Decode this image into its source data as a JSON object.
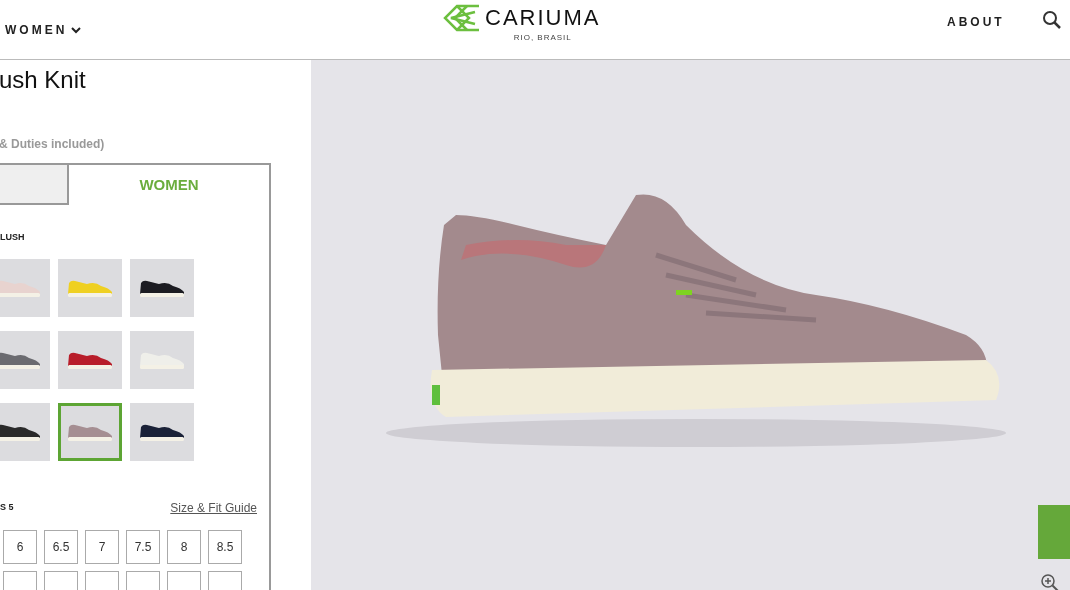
{
  "nav": {
    "menu": "WOMEN",
    "about": "ABOUT"
  },
  "logo": {
    "name": "CARIUMA",
    "tagline": "RIO, BRASIL"
  },
  "product": {
    "title": "ush Knit",
    "price_note": "& Duties included)"
  },
  "tabs": [
    {
      "selected": false
    },
    {
      "label": "WOMEN",
      "selected": true
    }
  ],
  "color_label": "LUSH",
  "swatches": [
    {
      "color": "#e8d3cf",
      "selected": false
    },
    {
      "color": "#efd021",
      "selected": false
    },
    {
      "color": "#1c1c22",
      "selected": false
    },
    {
      "color": "#6b6b70",
      "selected": false
    },
    {
      "color": "#b81d2a",
      "selected": false
    },
    {
      "color": "#efefea",
      "selected": false
    },
    {
      "color": "#2a2a2a",
      "selected": false
    },
    {
      "color": "#a58e92",
      "selected": true
    },
    {
      "color": "#1b2238",
      "selected": false
    }
  ],
  "size_label": "S 5",
  "size_guide": "Size & Fit Guide",
  "sizes": [
    {
      "label": "6"
    },
    {
      "label": "6.5"
    },
    {
      "label": "7"
    },
    {
      "label": "7.5"
    },
    {
      "label": "8"
    },
    {
      "label": "8.5"
    }
  ]
}
